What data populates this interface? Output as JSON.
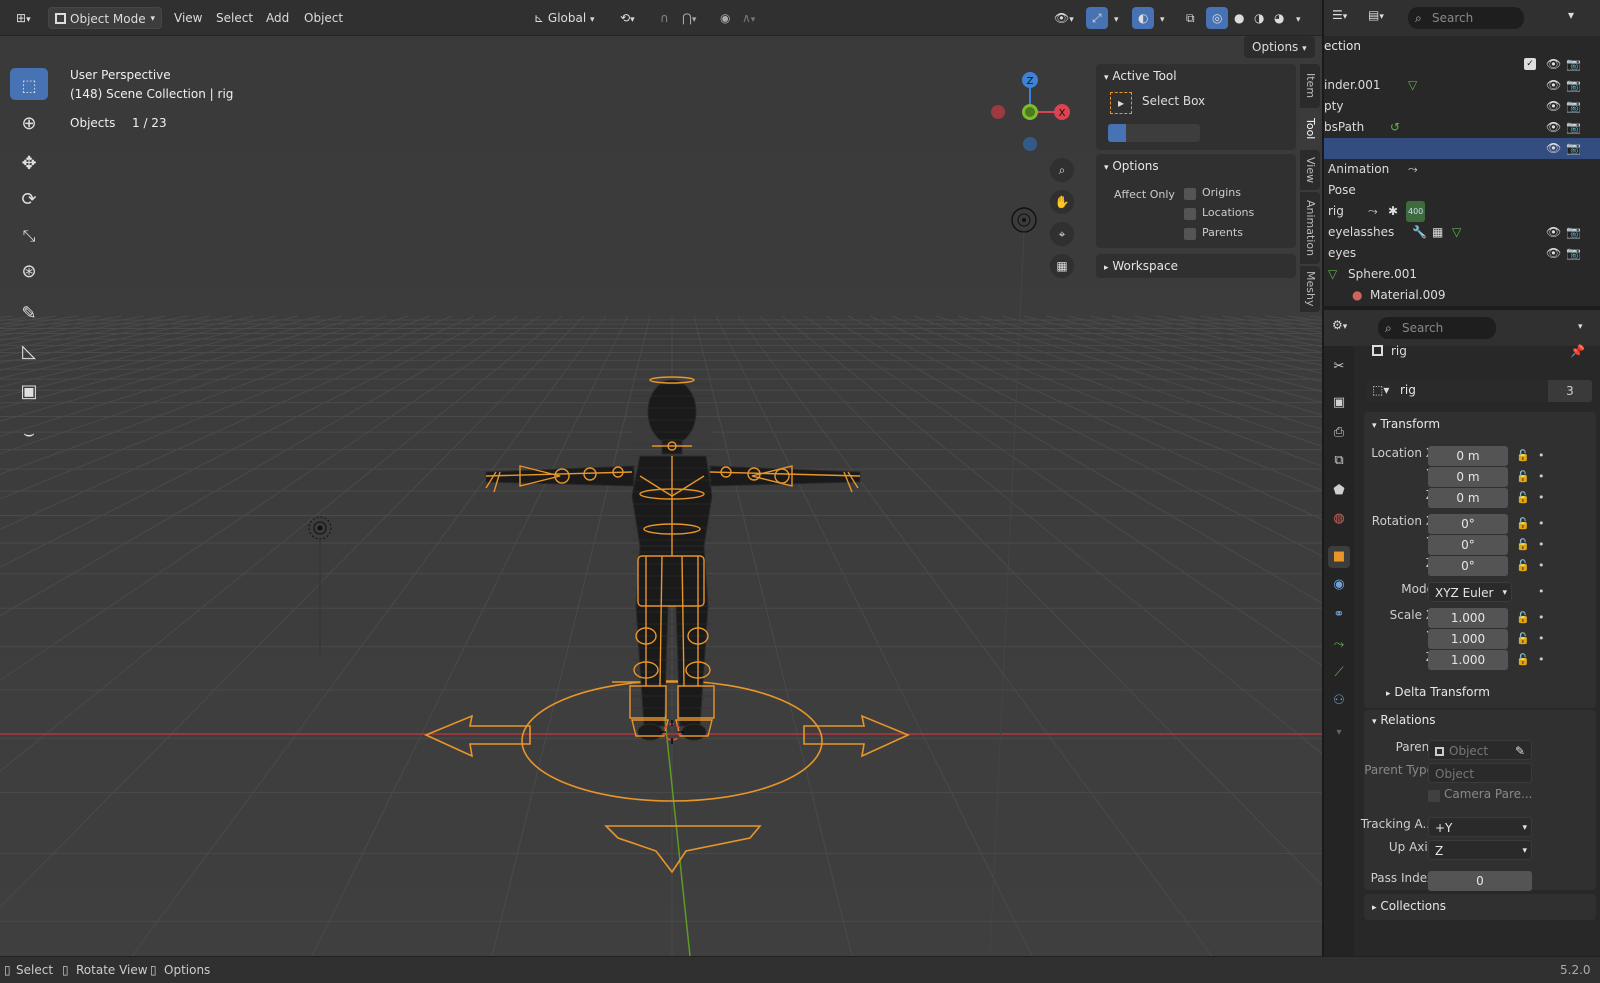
{
  "header": {
    "editor_type_icon": "viewport-icon",
    "mode": "Object Mode",
    "menus": [
      "View",
      "Select",
      "Add",
      "Object"
    ],
    "orientation": "Global",
    "options_label": "Options"
  },
  "viewport": {
    "perspective": "User Perspective",
    "collection_info": "(148) Scene Collection | rig",
    "objects_label": "Objects",
    "objects_count": "1 / 23"
  },
  "npanel": {
    "tabs": [
      "Item",
      "Tool",
      "View",
      "Animation",
      "Meshy"
    ],
    "active_tool_title": "Active Tool",
    "active_tool_name": "Select Box",
    "options_title": "Options",
    "affect_only_label": "Affect Only",
    "affect_options": [
      "Origins",
      "Locations",
      "Parents"
    ],
    "workspace_title": "Workspace"
  },
  "outliner": {
    "search_placeholder": "Search",
    "header_label": "ection",
    "rows": [
      {
        "label": "",
        "selected": false
      },
      {
        "label": "inder.001",
        "selected": false
      },
      {
        "label": "pty",
        "selected": false
      },
      {
        "label": "bsPath",
        "selected": false
      },
      {
        "label": "",
        "selected": true
      },
      {
        "label": "Animation",
        "selected": false
      },
      {
        "label": "Pose",
        "selected": false
      },
      {
        "label": "rig",
        "selected": false
      },
      {
        "label": "eyelasshes",
        "selected": false
      },
      {
        "label": "eyes",
        "selected": false
      },
      {
        "label": "Sphere.001",
        "selected": false
      },
      {
        "label": "Material.009",
        "selected": false
      }
    ],
    "rig_badge": "400"
  },
  "properties": {
    "search_placeholder": "Search",
    "object_name_header": "rig",
    "datablock_name": "rig",
    "datablock_users": "3",
    "transform_title": "Transform",
    "location": {
      "label_x": "Location X",
      "x": "0 m",
      "y": "0 m",
      "z": "0 m"
    },
    "rotation": {
      "label_x": "Rotation X",
      "x": "0°",
      "y": "0°",
      "z": "0°"
    },
    "mode_label": "Mode",
    "mode_value": "XYZ Euler",
    "scale": {
      "label_x": "Scale X",
      "x": "1.000",
      "y": "1.000",
      "z": "1.000"
    },
    "axis_y": "Y",
    "axis_z": "Z",
    "delta_title": "Delta Transform",
    "relations_title": "Relations",
    "parent_label": "Parent",
    "parent_value": "Object",
    "parent_type_label": "Parent Type",
    "parent_type_value": "Object",
    "camera_parent_label": "Camera Pare...",
    "tracking_label": "Tracking A...",
    "tracking_value": "+Y",
    "up_axis_label": "Up Axis",
    "up_axis_value": "Z",
    "pass_index_label": "Pass Index",
    "pass_index_value": "0",
    "collections_title": "Collections"
  },
  "statusbar": {
    "items": [
      "Select",
      "Rotate View",
      "Options"
    ],
    "version": "5.2.0"
  },
  "colors": {
    "accent": "#4772b3",
    "selection_orange": "#e8952a",
    "x_axis": "#d9444e",
    "y_axis": "#7cbc32",
    "z_axis": "#3e82d6"
  }
}
